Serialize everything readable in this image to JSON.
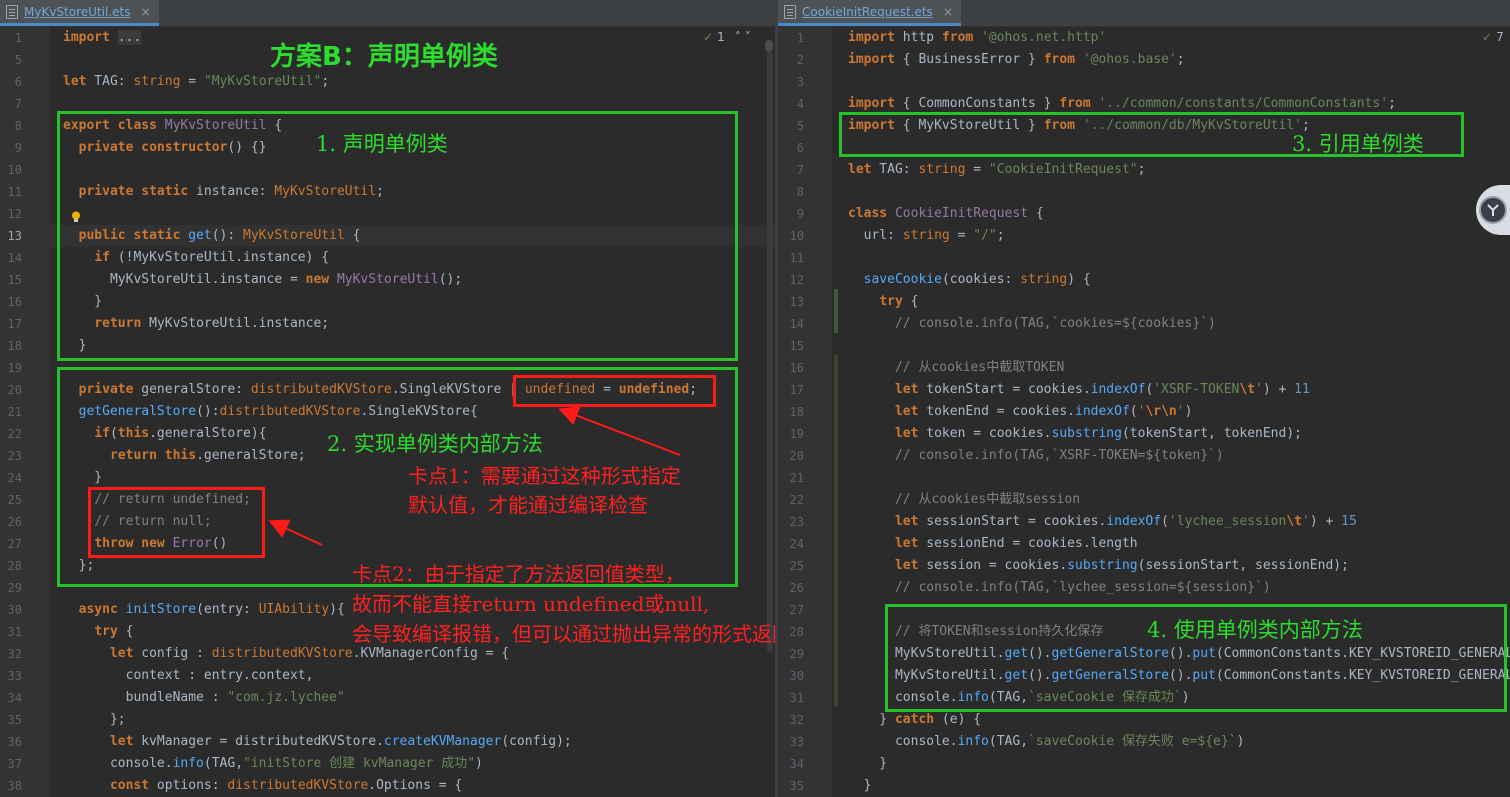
{
  "left": {
    "tab_name": "MyKvStoreUtil.ets",
    "tab_close": "×",
    "inspection_count": "1",
    "lines": [
      {
        "n": "1",
        "html": "<span class='kw'>import</span> <span style='background:#3b3b3b;color:#a9b7c6'>...</span>"
      },
      {
        "n": "5",
        "html": ""
      },
      {
        "n": "6",
        "html": "<span class='kw'>let</span> TAG: <span class='orange'>string</span> = <span class='str'>\"MyKvStoreUtil\"</span>;"
      },
      {
        "n": "7",
        "html": ""
      },
      {
        "n": "8",
        "html": "<span class='kw'>export class</span> <span class='ty'>MyKvStoreUtil</span> {"
      },
      {
        "n": "9",
        "html": "  <span class='kw'>private constructor</span>() {}"
      },
      {
        "n": "10",
        "html": ""
      },
      {
        "n": "11",
        "html": "  <span class='kw'>private static</span> instance: <span class='orange'>MyKvStoreUtil</span>;"
      },
      {
        "n": "12",
        "html": ""
      },
      {
        "n": "13",
        "html": "  <span class='kw'>public static</span> <span class='fn'>get</span>(): <span class='orange'>MyKvStoreUtil</span> {"
      },
      {
        "n": "14",
        "html": "    <span class='kw'>if</span> (!MyKvStoreUtil.instance) {"
      },
      {
        "n": "15",
        "html": "      MyKvStoreUtil.instance = <span class='kw'>new</span> <span class='ty'>MyKvStoreUtil</span>();"
      },
      {
        "n": "16",
        "html": "    }"
      },
      {
        "n": "17",
        "html": "    <span class='kw'>return</span> MyKvStoreUtil.instance;"
      },
      {
        "n": "18",
        "html": "  }"
      },
      {
        "n": "19",
        "html": ""
      },
      {
        "n": "20",
        "html": "  <span class='kw'>private</span> generalStore: <span class='orange'>distributedKVStore</span>.SingleKVStore | <span class='orange'>undefined</span> = <span class='kw'>undefined</span>;"
      },
      {
        "n": "21",
        "html": "  <span class='fn'>getGeneralStore</span>():<span class='orange'>distributedKVStore</span>.SingleKVStore{"
      },
      {
        "n": "22",
        "html": "    <span class='kw'>if</span>(<span class='kw'>this</span>.generalStore){"
      },
      {
        "n": "23",
        "html": "      <span class='kw'>return this</span>.generalStore;"
      },
      {
        "n": "24",
        "html": "    }"
      },
      {
        "n": "25",
        "html": "    <span class='cm'>// return undefined;</span>"
      },
      {
        "n": "26",
        "html": "    <span class='cm'>// return null;</span>"
      },
      {
        "n": "27",
        "html": "    <span class='kw'>throw new</span> <span class='ty'>Error</span>()"
      },
      {
        "n": "28",
        "html": "  };"
      },
      {
        "n": "29",
        "html": ""
      },
      {
        "n": "30",
        "html": "  <span class='kw'>async</span> <span class='fn'>initStore</span>(entry: <span class='orange'>UIAbility</span>){"
      },
      {
        "n": "31",
        "html": "    <span class='kw'>try</span> {"
      },
      {
        "n": "32",
        "html": "      <span class='kw'>let</span> config : <span class='orange'>distributedKVStore</span>.KVManagerConfig = {"
      },
      {
        "n": "33",
        "html": "        context : entry.context,"
      },
      {
        "n": "34",
        "html": "        bundleName : <span class='str'>\"com.jz.lychee\"</span>"
      },
      {
        "n": "35",
        "html": "      };"
      },
      {
        "n": "36",
        "html": "      <span class='kw'>let</span> kvManager = distributedKVStore.<span class='fn'>createKVManager</span>(config);"
      },
      {
        "n": "37",
        "html": "      console.<span class='fn'>info</span>(TAG,<span class='str'>\"initStore 创建 kvManager 成功\"</span>)"
      },
      {
        "n": "38",
        "html": "      <span class='kw'>const</span> options: <span class='orange'>distributedKVStore</span>.Options = {"
      }
    ],
    "annotations": {
      "title": "方案B：声明单例类",
      "step1": "1. 声明单例类",
      "step2": "2.  实现单例类内部方法",
      "note1_line1": "卡点1：需要通过这种形式指定",
      "note1_line2": "默认值，才能通过编译检查",
      "note2_line1": "卡点2：由于指定了方法返回值类型，",
      "note2_line2": "故而不能直接return undefined或null,",
      "note2_line3": "会导致编译报错，但可以通过抛出异常的形式返回"
    }
  },
  "right": {
    "tab_name": "CookieInitRequest.ets",
    "tab_close": "×",
    "inspection_count": "7",
    "lines": [
      {
        "n": "1",
        "html": "<span class='kw'>import</span> http <span class='kw'>from</span> <span class='str'>'@ohos.net.http'</span>"
      },
      {
        "n": "2",
        "html": "<span class='kw'>import</span> { BusinessError } <span class='kw'>from</span> <span class='str'>'@ohos.base'</span>;"
      },
      {
        "n": "3",
        "html": ""
      },
      {
        "n": "4",
        "html": "<span class='kw'>import</span> { CommonConstants } <span class='kw'>from</span> <span class='str'>'../common/constants/CommonConstants'</span>;"
      },
      {
        "n": "5",
        "html": "<span class='kw'>import</span> { MyKvStoreUtil } <span class='kw'>from</span> <span class='str'>'../common/db/MyKvStoreUtil'</span>;"
      },
      {
        "n": "6",
        "html": ""
      },
      {
        "n": "7",
        "html": "<span class='kw'>let</span> TAG: <span class='orange'>string</span> = <span class='str'>\"CookieInitRequest\"</span>;"
      },
      {
        "n": "8",
        "html": ""
      },
      {
        "n": "9",
        "html": "<span class='kw'>class</span> <span class='ty'>CookieInitRequest</span> {"
      },
      {
        "n": "10",
        "html": "  url: <span class='orange'>string</span> = <span class='str'>\"/\"</span>;"
      },
      {
        "n": "11",
        "html": ""
      },
      {
        "n": "12",
        "html": "  <span class='fn'>saveCookie</span>(cookies: <span class='orange'>string</span>) {"
      },
      {
        "n": "13",
        "html": "    <span class='kw'>try</span> {"
      },
      {
        "n": "14",
        "html": "      <span class='cm'>// console.info(TAG,`cookies=${cookies}`)</span>"
      },
      {
        "n": "15",
        "html": ""
      },
      {
        "n": "16",
        "html": "      <span class='cm'>// 从cookies中截取TOKEN</span>"
      },
      {
        "n": "17",
        "html": "      <span class='kw'>let</span> tokenStart = cookies.<span class='fn'>indexOf</span>(<span class='str'>'XSRF-TOKEN</span><span class='kw'>\\t</span><span class='str'>'</span>) + <span class='num'>11</span>"
      },
      {
        "n": "18",
        "html": "      <span class='kw'>let</span> tokenEnd = cookies.<span class='fn'>indexOf</span>(<span class='str'>'</span><span class='kw'>\\r\\n</span><span class='str'>'</span>)"
      },
      {
        "n": "19",
        "html": "      <span class='kw'>let</span> token = cookies.<span class='fn'>substring</span>(tokenStart, tokenEnd);"
      },
      {
        "n": "20",
        "html": "      <span class='cm'>// console.info(TAG,`XSRF-TOKEN=${token}`)</span>"
      },
      {
        "n": "21",
        "html": ""
      },
      {
        "n": "22",
        "html": "      <span class='cm'>// 从cookies中截取session</span>"
      },
      {
        "n": "23",
        "html": "      <span class='kw'>let</span> sessionStart = cookies.<span class='fn'>indexOf</span>(<span class='str'>'lychee_session</span><span class='kw'>\\t</span><span class='str'>'</span>) + <span class='num'>15</span>"
      },
      {
        "n": "24",
        "html": "      <span class='kw'>let</span> sessionEnd = cookies.length"
      },
      {
        "n": "25",
        "html": "      <span class='kw'>let</span> session = cookies.<span class='fn'>substring</span>(sessionStart, sessionEnd);"
      },
      {
        "n": "26",
        "html": "      <span class='cm'>// console.info(TAG,`lychee_session=${session}`)</span>"
      },
      {
        "n": "27",
        "html": ""
      },
      {
        "n": "28",
        "html": "      <span class='cm'>// 将TOKEN和session持久化保存</span>"
      },
      {
        "n": "29",
        "html": "      MyKvStoreUtil.<span class='fn'>get</span>().<span class='fn'>getGeneralStore</span>().<span class='fn'>put</span>(CommonConstants.KEY_KVSTOREID_GENERAL_TOKEN"
      },
      {
        "n": "30",
        "html": "      MyKvStoreUtil.<span class='fn'>get</span>().<span class='fn'>getGeneralStore</span>().<span class='fn'>put</span>(CommonConstants.KEY_KVSTOREID_GENERAL_SESSION"
      },
      {
        "n": "31",
        "html": "      console.<span class='fn'>info</span>(TAG,<span class='str'>`saveCookie 保存成功`</span>)"
      },
      {
        "n": "32",
        "html": "    } <span class='kw'>catch</span> (e) {"
      },
      {
        "n": "33",
        "html": "      console.<span class='fn'>info</span>(TAG,<span class='str'>`saveCookie 保存失败 e=${e}`</span>)"
      },
      {
        "n": "34",
        "html": "    }"
      },
      {
        "n": "35",
        "html": "  }"
      }
    ],
    "annotations": {
      "step3": "3. 引用单例类",
      "step4": "4.  使用单例类内部方法"
    }
  },
  "colors": {
    "green": "#26c22a",
    "red": "#ff1a1a"
  }
}
